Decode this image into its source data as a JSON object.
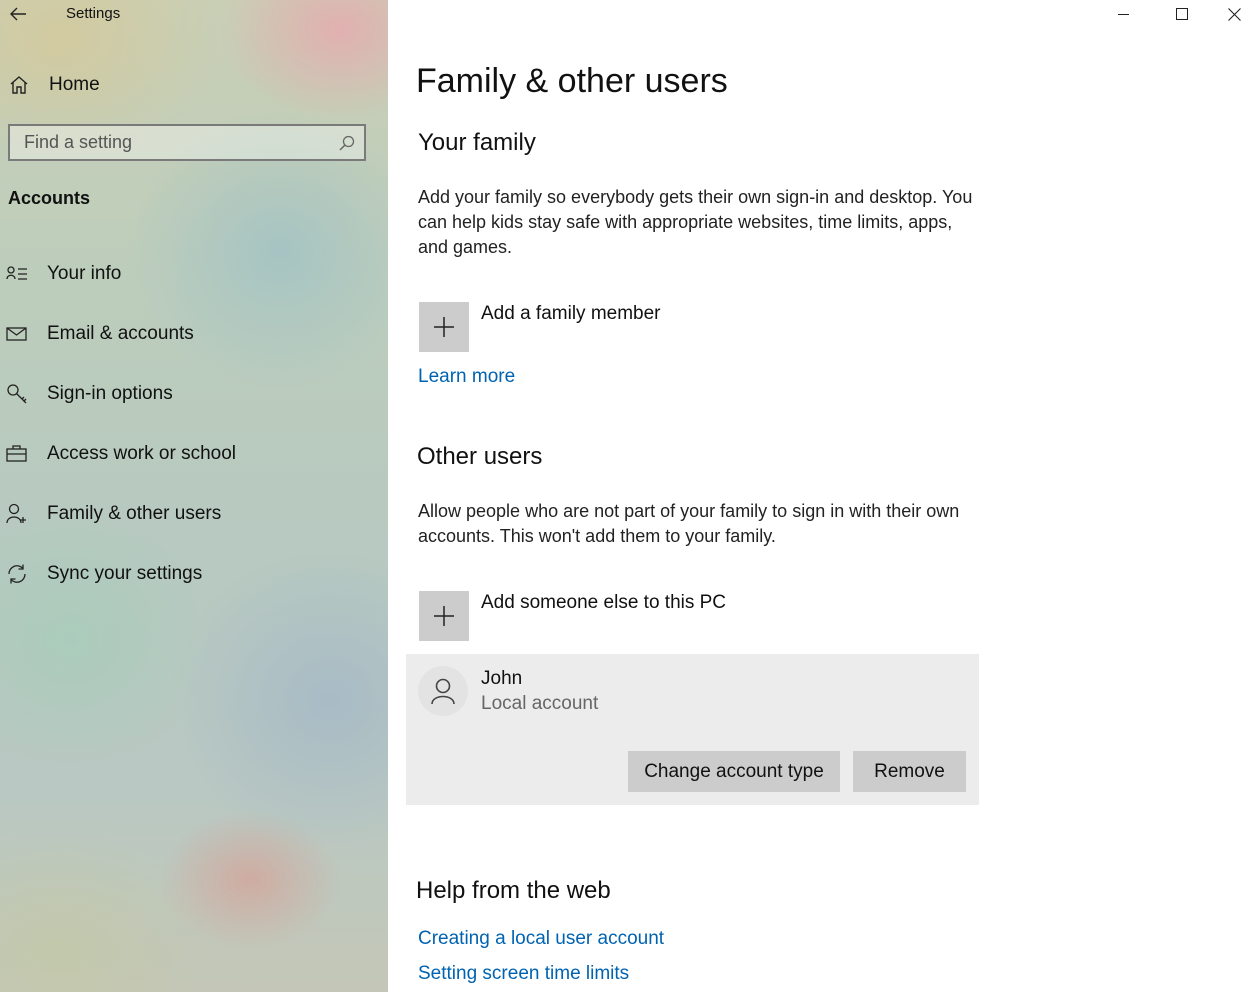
{
  "window": {
    "title": "Settings",
    "controls": [
      "minimize-icon",
      "maximize-icon",
      "close-icon"
    ]
  },
  "sidebar": {
    "home_label": "Home",
    "search_placeholder": "Find a setting",
    "section_label": "Accounts",
    "items": [
      {
        "label": "Your info",
        "icon": "person-card-icon"
      },
      {
        "label": "Email & accounts",
        "icon": "mail-icon"
      },
      {
        "label": "Sign-in options",
        "icon": "key-icon"
      },
      {
        "label": "Access work or school",
        "icon": "briefcase-icon"
      },
      {
        "label": "Family & other users",
        "icon": "person-add-icon"
      },
      {
        "label": "Sync your settings",
        "icon": "sync-icon"
      }
    ]
  },
  "main": {
    "title": "Family & other users",
    "family": {
      "heading": "Your family",
      "description": "Add your family so everybody gets their own sign-in and desktop. You can help kids stay safe with appropriate websites, time limits, apps, and games.",
      "add_label": "Add a family member",
      "learn_more": "Learn more"
    },
    "other_users": {
      "heading": "Other users",
      "description": "Allow people who are not part of your family to sign in with their own accounts. This won't add them to your family.",
      "add_label": "Add someone else to this PC",
      "user": {
        "name": "John",
        "type": "Local account",
        "change_button": "Change account type",
        "remove_button": "Remove"
      }
    },
    "help": {
      "heading": "Help from the web",
      "links": [
        "Creating a local user account",
        "Setting screen time limits"
      ]
    }
  },
  "colors": {
    "link": "#0063b1",
    "button": "#cccccc",
    "card": "#ececec"
  }
}
